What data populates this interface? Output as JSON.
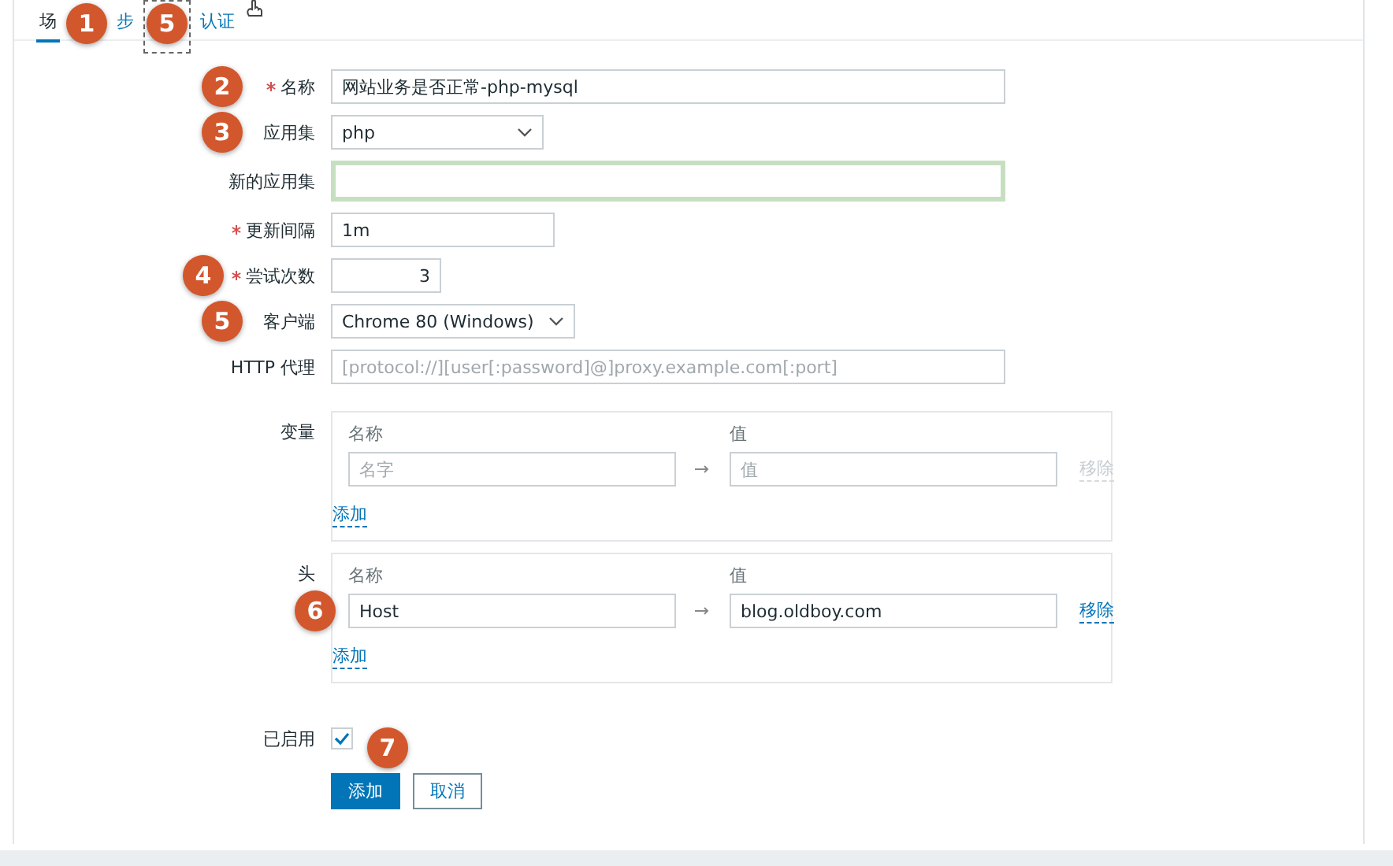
{
  "tabs": [
    {
      "label": "场",
      "selected": true,
      "badge": "1"
    },
    {
      "label": "步",
      "selected": false,
      "badge": "5"
    },
    {
      "label": "认证",
      "selected": false
    }
  ],
  "fields": [
    {
      "label": "名称",
      "required": true,
      "kind": "text",
      "value": "网站业务是否正常-php-mysql",
      "badge": "2"
    },
    {
      "label": "应用集",
      "required": false,
      "kind": "select",
      "value": "php",
      "badge": "3"
    },
    {
      "label": "新的应用集",
      "required": false,
      "kind": "text",
      "focused": true
    },
    {
      "label": "更新间隔",
      "required": true,
      "kind": "text",
      "value": "1m"
    },
    {
      "label": "尝试次数",
      "required": true,
      "kind": "number",
      "value": "3",
      "badge": "4"
    },
    {
      "label": "客户端",
      "required": false,
      "kind": "select",
      "value": "Chrome 80 (Windows)",
      "badge": "5"
    },
    {
      "label": "HTTP 代理",
      "required": false,
      "kind": "text",
      "placeholder": "[protocol://][user[:password]@]proxy.example.com[:port]"
    }
  ],
  "pair_tables": [
    {
      "label": "变量",
      "name_header": "名称",
      "value_header": "值",
      "add_link": "添加",
      "rows": [
        {
          "name_placeholder": "名字",
          "value_placeholder": "值",
          "remove": "移除",
          "disabled": true
        }
      ]
    },
    {
      "label": "头",
      "name_header": "名称",
      "value_header": "值",
      "add_link": "添加",
      "rows": [
        {
          "name": "Host",
          "value": "blog.oldboy.com",
          "remove": "移除",
          "disabled": false,
          "badge": "6"
        }
      ]
    }
  ],
  "enabled": {
    "label": "已启用",
    "checked": true
  },
  "buttons": [
    {
      "label": "添加",
      "kind": "primary",
      "badge": "7"
    },
    {
      "label": "取消",
      "kind": "secondary"
    }
  ]
}
